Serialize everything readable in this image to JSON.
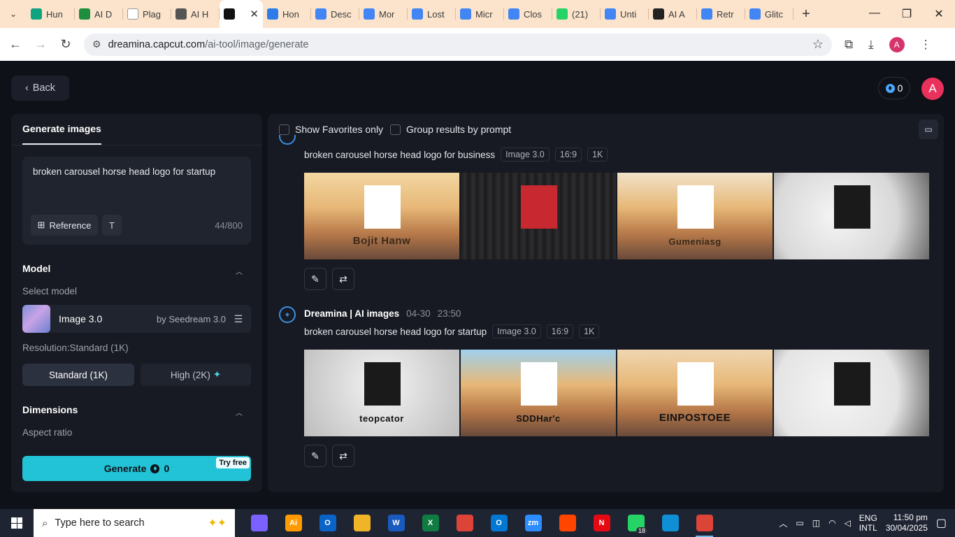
{
  "browser": {
    "tabs": [
      {
        "label": "Hun",
        "icon": "chatgpt-icon",
        "color": "#10a37f"
      },
      {
        "label": "AI D",
        "icon": "sheet-icon",
        "color": "#1e8e3e"
      },
      {
        "label": "Plag",
        "icon": "sst-icon",
        "color": "#ffffff"
      },
      {
        "label": "AI H",
        "icon": "globe-icon",
        "color": "#555555"
      },
      {
        "label": "",
        "icon": "capcut-icon",
        "color": "#111111",
        "active": true
      },
      {
        "label": "Hon",
        "icon": "bird-icon",
        "color": "#2b7de9"
      },
      {
        "label": "Desc",
        "icon": "doc-icon",
        "color": "#4285f4"
      },
      {
        "label": "Mor",
        "icon": "doc-icon",
        "color": "#4285f4"
      },
      {
        "label": "Lost",
        "icon": "doc-icon",
        "color": "#4285f4"
      },
      {
        "label": "Micr",
        "icon": "doc-icon",
        "color": "#4285f4"
      },
      {
        "label": "Clos",
        "icon": "doc-icon",
        "color": "#4285f4"
      },
      {
        "label": "(21)",
        "icon": "whatsapp-icon",
        "color": "#25d366"
      },
      {
        "label": "Unti",
        "icon": "form-icon",
        "color": "#4285f4"
      },
      {
        "label": "AI A",
        "icon": "openai-icon",
        "color": "#222222"
      },
      {
        "label": "Retr",
        "icon": "doc-icon",
        "color": "#4285f4"
      },
      {
        "label": "Glitc",
        "icon": "doc-icon",
        "color": "#4285f4"
      }
    ],
    "url_domain": "dreamina.capcut.com",
    "url_path": "/ai-tool/image/generate",
    "profile_initial": "A"
  },
  "header": {
    "back_label": "Back",
    "credits": "0",
    "avatar_initial": "A"
  },
  "left": {
    "tab_label": "Generate images",
    "prompt": "broken carousel horse head logo for startup",
    "reference_label": "Reference",
    "char_count": "44/800",
    "model_title": "Model",
    "select_model_label": "Select model",
    "model_name": "Image 3.0",
    "model_by": "by Seedream 3.0",
    "resolution_label": "Resolution:Standard (1K)",
    "res_standard": "Standard (1K)",
    "res_high": "High (2K)",
    "dimensions_title": "Dimensions",
    "aspect_label": "Aspect ratio",
    "generate_label": "Generate",
    "generate_cost": "0",
    "try_free": "Try free"
  },
  "right": {
    "show_favorites": "Show Favorites only",
    "group_results": "Group results by prompt",
    "groups": [
      {
        "prompt": "broken carousel horse head logo for business",
        "tags": [
          "Image 3.0",
          "16:9",
          "1K"
        ],
        "images": [
          {
            "caption": "Bojit Hanw",
            "scene": "carousel-bg",
            "color": "#f3d7a1"
          },
          {
            "caption": "",
            "scene": "wood-bg",
            "color": "#2a2a2c"
          },
          {
            "caption": "Gumeniasg",
            "scene": "carousel-bg",
            "color": "#f1e2c8"
          },
          {
            "caption": "",
            "scene": "grey-bg",
            "color": "#d8d8d8"
          }
        ]
      },
      {
        "bot": "Dreamina | AI images",
        "date": "04-30",
        "time": "23:50",
        "prompt": "broken carousel horse head logo for startup",
        "tags": [
          "Image 3.0",
          "16:9",
          "1K"
        ],
        "images": [
          {
            "caption": "teopcator",
            "scene": "cracked-bg",
            "color": "#e8e8e8"
          },
          {
            "caption": "SDDHar'c",
            "scene": "carousel-bg",
            "color": "#9fd0ec"
          },
          {
            "caption": "EINPOSTOEE",
            "scene": "carousel-bg",
            "color": "#f0d6b0"
          },
          {
            "caption": "",
            "scene": "grey-bg",
            "color": "#e4e4e4"
          }
        ]
      }
    ]
  },
  "taskbar": {
    "search_placeholder": "Type here to search",
    "apps": [
      {
        "name": "copilot-icon",
        "label": "",
        "color": "#7b61ff"
      },
      {
        "name": "illustrator-icon",
        "label": "Ai",
        "color": "#ff9a00"
      },
      {
        "name": "outlook-icon",
        "label": "O",
        "color": "#0a64c8"
      },
      {
        "name": "explorer-icon",
        "label": "",
        "color": "#f0b429"
      },
      {
        "name": "word-icon",
        "label": "W",
        "color": "#185abd"
      },
      {
        "name": "excel-icon",
        "label": "X",
        "color": "#107c41"
      },
      {
        "name": "chrome-icon",
        "label": "",
        "color": "#db4437"
      },
      {
        "name": "outlook-new-icon",
        "label": "O",
        "color": "#0078d4"
      },
      {
        "name": "zoom-icon",
        "label": "zm",
        "color": "#2d8cff"
      },
      {
        "name": "reddit-icon",
        "label": "",
        "color": "#ff4500"
      },
      {
        "name": "netflix-icon",
        "label": "N",
        "color": "#e50914"
      },
      {
        "name": "whatsapp-icon",
        "label": "",
        "color": "#25d366",
        "badge": "18"
      },
      {
        "name": "edge-icon",
        "label": "",
        "color": "#0f8fd6"
      },
      {
        "name": "chrome-profile-icon",
        "label": "",
        "color": "#db4437",
        "active": true
      }
    ],
    "lang_top": "ENG",
    "lang_bottom": "INTL",
    "time": "11:50 pm",
    "date": "30/04/2025"
  }
}
